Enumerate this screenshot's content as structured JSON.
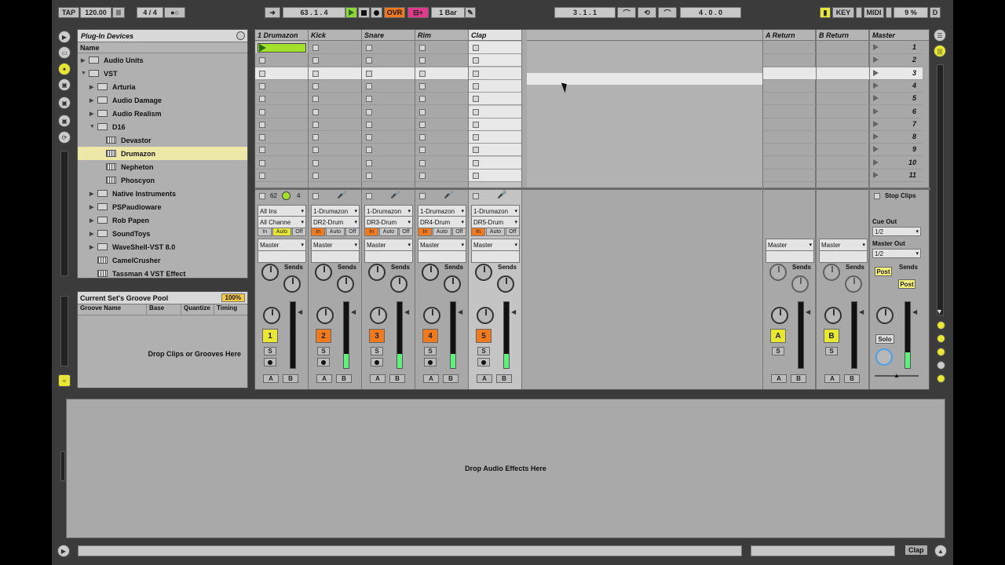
{
  "transport": {
    "tap": "TAP",
    "tempo": "120.00",
    "signature_num": "4",
    "signature_den": "4",
    "position": "63 .  1 .  4",
    "ovr": "OVR",
    "quant": "1 Bar",
    "loop_start": "3 .  1 .  1",
    "loop_len": "4 .  0 .  0",
    "key": "KEY",
    "midi": "MIDI",
    "cpu": "9 %",
    "d": "D"
  },
  "browser": {
    "title": "Plug-In Devices",
    "col_name": "Name",
    "items": [
      {
        "label": "Audio Units",
        "depth": 0,
        "kind": "folder",
        "toggle": "▶"
      },
      {
        "label": "VST",
        "depth": 0,
        "kind": "folder",
        "toggle": "▼"
      },
      {
        "label": "Arturia",
        "depth": 1,
        "kind": "folder",
        "toggle": "▶"
      },
      {
        "label": "Audio Damage",
        "depth": 1,
        "kind": "folder",
        "toggle": "▶"
      },
      {
        "label": "Audio Realism",
        "depth": 1,
        "kind": "folder",
        "toggle": "▶"
      },
      {
        "label": "D16",
        "depth": 1,
        "kind": "folder",
        "toggle": "▼"
      },
      {
        "label": "Devastor",
        "depth": 2,
        "kind": "plugin",
        "toggle": ""
      },
      {
        "label": "Drumazon",
        "depth": 2,
        "kind": "plugin",
        "toggle": "",
        "selected": true
      },
      {
        "label": "Nepheton",
        "depth": 2,
        "kind": "plugin",
        "toggle": ""
      },
      {
        "label": "Phoscyon",
        "depth": 2,
        "kind": "plugin",
        "toggle": ""
      },
      {
        "label": "Native Instruments",
        "depth": 1,
        "kind": "folder",
        "toggle": "▶"
      },
      {
        "label": "PSPaudioware",
        "depth": 1,
        "kind": "folder",
        "toggle": "▶"
      },
      {
        "label": "Rob Papen",
        "depth": 1,
        "kind": "folder",
        "toggle": "▶"
      },
      {
        "label": "SoundToys",
        "depth": 1,
        "kind": "folder",
        "toggle": "▶"
      },
      {
        "label": "WaveShell-VST 8.0",
        "depth": 1,
        "kind": "folder",
        "toggle": "▶"
      },
      {
        "label": "CamelCrusher",
        "depth": 1,
        "kind": "plugin",
        "toggle": ""
      },
      {
        "label": "Tassman 4 VST Effect",
        "depth": 1,
        "kind": "plugin",
        "toggle": ""
      }
    ]
  },
  "groove": {
    "title": "Current Set's Groove Pool",
    "amount": "100%",
    "cols": [
      "Groove Name",
      "Base",
      "Quantize",
      "Timing"
    ],
    "drop": "Drop Clips or Grooves Here"
  },
  "tracks": [
    {
      "name": "1 Drumazon",
      "num": "1",
      "in1": "All Ins",
      "in2": "All Channe",
      "numcolor": "#e8e832",
      "monitor": "Auto",
      "extra": "62",
      "extra2": "4"
    },
    {
      "name": "Kick",
      "num": "2",
      "in1": "1-Drumazon",
      "in2": "DR2-Drum",
      "numcolor": "#f07a1c",
      "monitor": "In"
    },
    {
      "name": "Snare",
      "num": "3",
      "in1": "1-Drumazon",
      "in2": "DR3-Drum",
      "numcolor": "#f07a1c",
      "monitor": "In"
    },
    {
      "name": "Rim",
      "num": "4",
      "in1": "1-Drumazon",
      "in2": "DR4-Drum",
      "numcolor": "#f07a1c",
      "monitor": "In"
    },
    {
      "name": "Clap",
      "num": "5",
      "in1": "1-Drumazon",
      "in2": "DR5-Drum",
      "numcolor": "#f07a1c",
      "monitor": "In"
    }
  ],
  "mon": {
    "in": "In",
    "auto": "Auto",
    "off": "Off"
  },
  "out": "Master",
  "sends": "Sends",
  "solo": "S",
  "ab": {
    "a": "A",
    "b": "B"
  },
  "returns": [
    {
      "name": "A Return",
      "letter": "A",
      "out": "Master"
    },
    {
      "name": "B Return",
      "letter": "B",
      "out": "Master"
    }
  ],
  "master": {
    "name": "Master",
    "scenes": [
      "1",
      "2",
      "3",
      "4",
      "5",
      "6",
      "7",
      "8",
      "9",
      "10",
      "11"
    ],
    "stop": "Stop Clips",
    "cue_label": "Cue Out",
    "cue_val": "1/2",
    "out_label": "Master Out",
    "out_val": "1/2",
    "post": "Post",
    "solo": "Solo"
  },
  "device_drop": "Drop Audio Effects Here",
  "status_track": "Clap"
}
